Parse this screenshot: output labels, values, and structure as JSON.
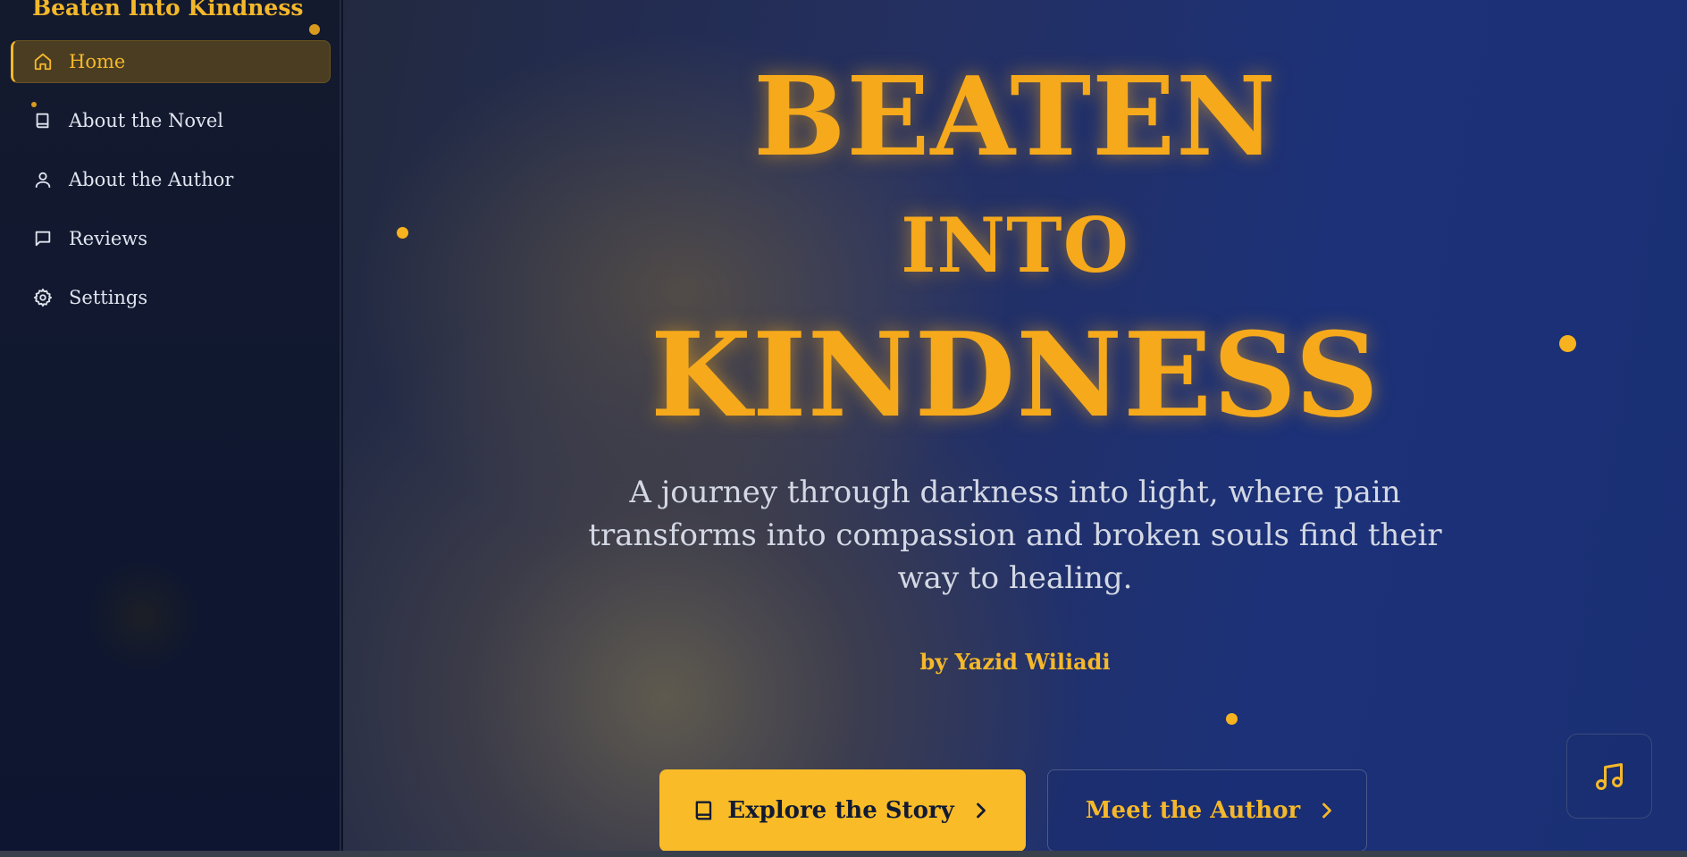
{
  "brand": {
    "title": "Beaten Into Kindness"
  },
  "sidebar": {
    "items": [
      {
        "label": "Home",
        "icon": "home-icon",
        "active": true
      },
      {
        "label": "About the Novel",
        "icon": "book-icon",
        "active": false
      },
      {
        "label": "About the Author",
        "icon": "user-icon",
        "active": false
      },
      {
        "label": "Reviews",
        "icon": "message-square-icon",
        "active": false
      },
      {
        "label": "Settings",
        "icon": "gear-icon",
        "active": false
      }
    ]
  },
  "hero": {
    "title_line1": "BEATEN",
    "title_line2": "INTO",
    "title_line3": "KINDNESS",
    "subtitle": "A journey through darkness into light, where pain transforms into compassion and broken souls find their way to healing.",
    "byline": "by Yazid Wiliadi",
    "primary_button": "Explore the Story",
    "secondary_button": "Meet the Author",
    "music_icon": "music-icon"
  },
  "colors": {
    "accent": "#f6a91b",
    "button_yellow": "#f9bb27",
    "sidebar_bg": "#0f1730",
    "main_bg": "#1c3178"
  }
}
